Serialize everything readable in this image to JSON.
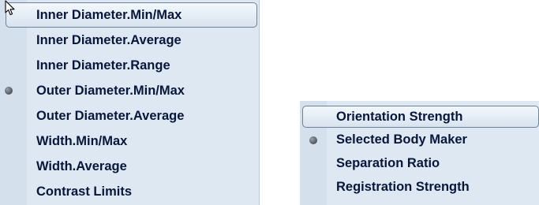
{
  "left_menu": {
    "items": [
      {
        "label": "Inner Diameter.Min/Max",
        "highlighted": true,
        "selected": false
      },
      {
        "label": "Inner Diameter.Average",
        "highlighted": false,
        "selected": false
      },
      {
        "label": "Inner Diameter.Range",
        "highlighted": false,
        "selected": false
      },
      {
        "label": "Outer Diameter.Min/Max",
        "highlighted": false,
        "selected": true
      },
      {
        "label": "Outer Diameter.Average",
        "highlighted": false,
        "selected": false
      },
      {
        "label": "Width.Min/Max",
        "highlighted": false,
        "selected": false
      },
      {
        "label": "Width.Average",
        "highlighted": false,
        "selected": false
      },
      {
        "label": "Contrast Limits",
        "highlighted": false,
        "selected": false
      }
    ]
  },
  "right_menu": {
    "items": [
      {
        "label": "Orientation Strength",
        "highlighted": true,
        "selected": false
      },
      {
        "label": "Selected Body Maker",
        "highlighted": false,
        "selected": true
      },
      {
        "label": "Separation Ratio",
        "highlighted": false,
        "selected": false
      },
      {
        "label": "Registration Strength",
        "highlighted": false,
        "selected": false
      }
    ]
  },
  "colors": {
    "menu_bg": "#dde8f3",
    "text": "#08163a",
    "highlight_border": "#6f8194",
    "bullet": "#5c646d"
  },
  "icons": {
    "cursor": "mouse-pointer-icon",
    "selected_marker": "radio-bullet-icon"
  }
}
